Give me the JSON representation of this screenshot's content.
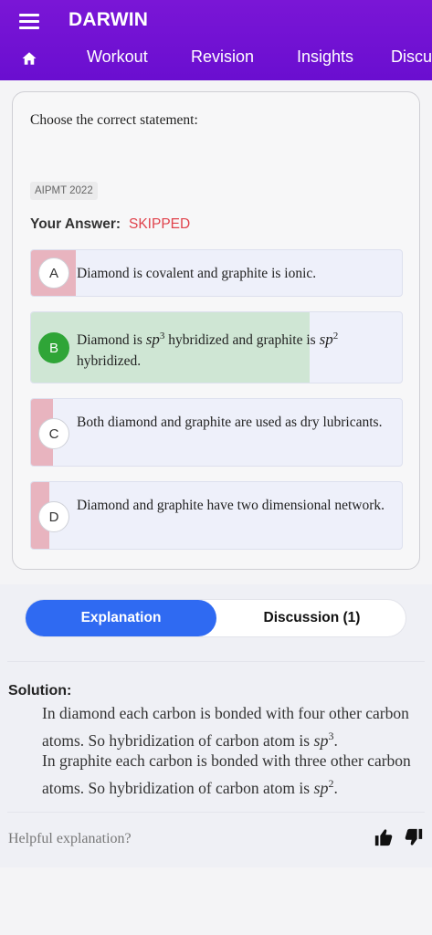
{
  "app": {
    "title": "DARWIN"
  },
  "nav": {
    "items": [
      "Workout",
      "Revision",
      "Insights",
      "Discu"
    ]
  },
  "question": {
    "text": "Choose the correct statement:",
    "tag": "AIPMT 2022",
    "your_answer_label": "Your Answer:",
    "your_answer_value": "SKIPPED"
  },
  "options": [
    {
      "letter": "A",
      "text": "Diamond is covalent and graphite is ionic.",
      "fill_fraction": 0.12,
      "correct": false
    },
    {
      "letter": "B",
      "text_parts": [
        "Diamond is ",
        "sp",
        "3",
        " hybridized and graphite is ",
        "sp",
        "2",
        " hybridized."
      ],
      "fill_fraction": 0.75,
      "correct": true
    },
    {
      "letter": "C",
      "text": "Both diamond and graphite are used as dry lubricants.",
      "fill_fraction": 0.06,
      "correct": false
    },
    {
      "letter": "D",
      "text": "Diamond and graphite have two dimensional network.",
      "fill_fraction": 0.05,
      "correct": false
    }
  ],
  "tabs": {
    "active": "Explanation",
    "other": "Discussion (1)"
  },
  "solution": {
    "label": "Solution:",
    "line1": "In diamond each carbon is bonded with four other carbon atoms. So hybridization of carbon atom is ",
    "line2": "In graphite each carbon is bonded with three other carbon atoms. So hybridization of carbon atom is ",
    "sp": "sp",
    "sp3_exp": "3",
    "sp2_exp": "2",
    "period": "."
  },
  "feedback": {
    "prompt": "Helpful explanation?"
  },
  "colors": {
    "brand": "#7a16d6",
    "accent": "#2f6af2",
    "correct": "#2fa537",
    "wrong_fill": "#e8b4bf",
    "correct_fill": "#cfe6d4",
    "skipped": "#e0434c"
  }
}
